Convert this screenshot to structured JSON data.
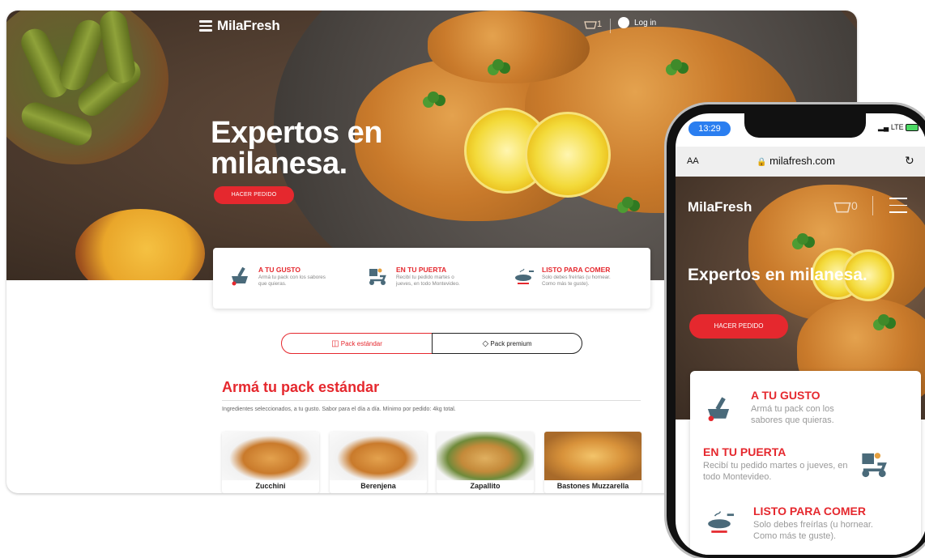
{
  "desktop": {
    "brand": "MilaFresh",
    "cart_count": "1",
    "login_label": "Log in",
    "hero_title": "Expertos en milanesa.",
    "cta_label": "HACER PEDIDO",
    "features": [
      {
        "icon": "mortar-icon",
        "title": "A TU GUSTO",
        "desc": "Armá tu pack con los sabores que quieras."
      },
      {
        "icon": "delivery-scooter-icon",
        "title": "EN TU PUERTA",
        "desc": "Recibí tu pedido martes o jueves, en todo Montevideo."
      },
      {
        "icon": "frying-pan-icon",
        "title": "LISTO PARA COMER",
        "desc": "Solo debes freírlas (u hornear. Como más te guste)."
      }
    ],
    "tabs": [
      {
        "icon": "box-icon",
        "label": "Pack estándar"
      },
      {
        "icon": "diamond-icon",
        "label": "Pack premium"
      }
    ],
    "section_title": "Armá tu pack estándar",
    "section_sub": "Ingredientes seleccionados, a tu gusto. Sabor para el día a día. Mínimo por pedido: 4kg total.",
    "products": [
      {
        "name": "Zucchini"
      },
      {
        "name": "Berenjena"
      },
      {
        "name": "Zapallito"
      },
      {
        "name": "Bastones Muzzarella"
      }
    ]
  },
  "mobile": {
    "time": "13:29",
    "status_right": "LTE",
    "text_size": "AA",
    "url": "milafresh.com",
    "brand": "MilaFresh",
    "cart_count": "0",
    "hero_title": "Expertos en milanesa.",
    "cta_label": "HACER PEDIDO",
    "features": [
      {
        "title": "A TU GUSTO",
        "desc": "Armá tu pack con los sabores que quieras."
      },
      {
        "title": "EN TU PUERTA",
        "desc": "Recibí tu pedido martes o jueves, en todo Montevideo."
      },
      {
        "title": "LISTO PARA COMER",
        "desc": "Solo debes freírlas (u hornear. Como más te guste)."
      }
    ]
  },
  "colors": {
    "accent": "#e5282e",
    "text": "#222222"
  }
}
